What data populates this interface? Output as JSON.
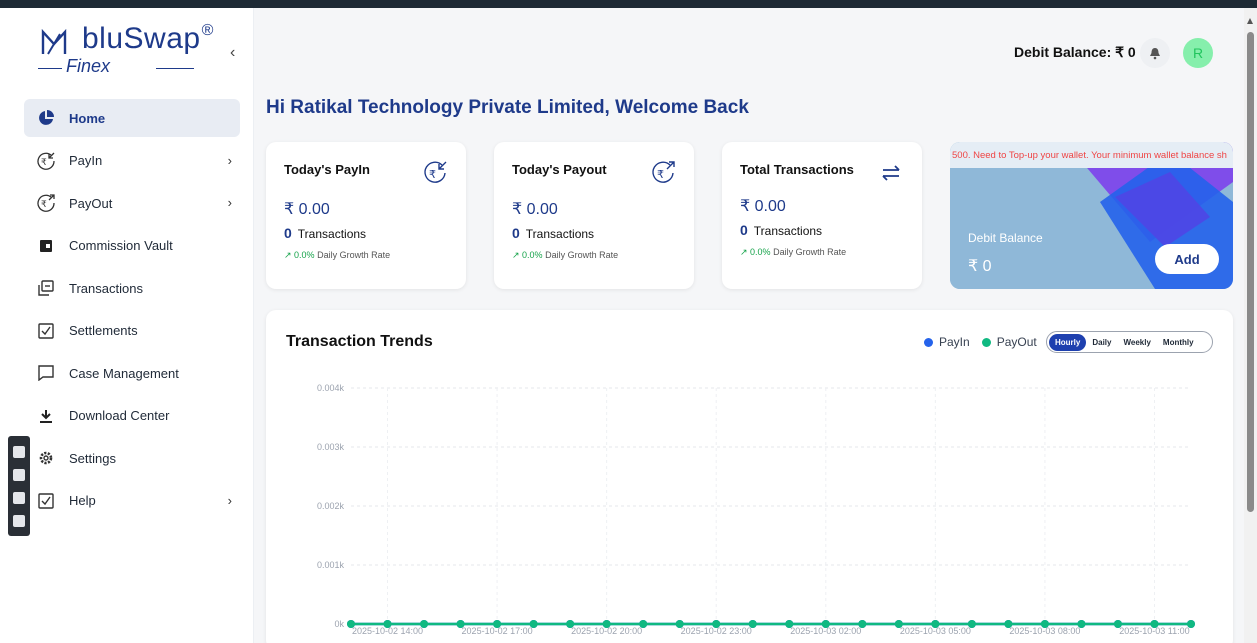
{
  "brand": {
    "name": "bluSwap",
    "registered": "®",
    "sub": "Finex"
  },
  "sidebar": {
    "items": [
      {
        "label": "Home",
        "icon": "pie-chart-icon",
        "active": true,
        "has_children": false
      },
      {
        "label": "PayIn",
        "icon": "rupee-in-icon",
        "active": false,
        "has_children": true
      },
      {
        "label": "PayOut",
        "icon": "rupee-out-icon",
        "active": false,
        "has_children": true
      },
      {
        "label": "Commission Vault",
        "icon": "wallet-icon",
        "active": false,
        "has_children": false
      },
      {
        "label": "Transactions",
        "icon": "transactions-icon",
        "active": false,
        "has_children": false
      },
      {
        "label": "Settlements",
        "icon": "checkbox-icon",
        "active": false,
        "has_children": false
      },
      {
        "label": "Case Management",
        "icon": "message-icon",
        "active": false,
        "has_children": false
      },
      {
        "label": "Download Center",
        "icon": "download-icon",
        "active": false,
        "has_children": false
      },
      {
        "label": "Settings",
        "icon": "gear-icon",
        "active": false,
        "has_children": false
      },
      {
        "label": "Help",
        "icon": "help-check-icon",
        "active": false,
        "has_children": true
      }
    ]
  },
  "header": {
    "debit_balance": "Debit Balance: ₹ 0",
    "avatar_initial": "R"
  },
  "welcome": "Hi Ratikal Technology Private Limited, Welcome Back",
  "cards": [
    {
      "title": "Today's PayIn",
      "amount": "₹ 0.00",
      "count": "0",
      "count_label": "Transactions",
      "growth": "0.0%",
      "growth_label": "Daily Growth Rate",
      "icon": "rupee-in-icon"
    },
    {
      "title": "Today's Payout",
      "amount": "₹ 0.00",
      "count": "0",
      "count_label": "Transactions",
      "growth": "0.0%",
      "growth_label": "Daily Growth Rate",
      "icon": "rupee-out-icon"
    },
    {
      "title": "Total Transactions",
      "amount": "₹ 0.00",
      "count": "0",
      "count_label": "Transactions",
      "growth": "0.0%",
      "growth_label": "Daily Growth Rate",
      "icon": "swap-arrows-icon"
    }
  ],
  "debit_card": {
    "marquee": "500. Need to Top-up your wallet. Your minimum wallet balance sh",
    "label": "Debit Balance",
    "amount": "₹ 0",
    "add_label": "Add"
  },
  "colors": {
    "brand": "#1e3a8a",
    "payin": "#2563eb",
    "payout": "#10b981",
    "growth": "#16a34a",
    "alert": "#ef4444"
  },
  "chart_data": {
    "type": "line",
    "title": "Transaction Trends",
    "legend": [
      "PayIn",
      "PayOut"
    ],
    "legend_placement": "top-right",
    "ranges": [
      "Hourly",
      "Daily",
      "Weekly",
      "Monthly"
    ],
    "selected_range": "Hourly",
    "y_ticks": [
      "0k",
      "0.001k",
      "0.002k",
      "0.003k",
      "0.004k"
    ],
    "ylim": [
      0,
      0.004
    ],
    "x_tick_labels": [
      "2025-10-02 14:00",
      "2025-10-02 17:00",
      "2025-10-02 20:00",
      "2025-10-02 23:00",
      "2025-10-03 02:00",
      "2025-10-03 05:00",
      "2025-10-03 08:00",
      "2025-10-03 11:00"
    ],
    "x_points": 24,
    "series": [
      {
        "name": "PayIn",
        "values": [
          0,
          0,
          0,
          0,
          0,
          0,
          0,
          0,
          0,
          0,
          0,
          0,
          0,
          0,
          0,
          0,
          0,
          0,
          0,
          0,
          0,
          0,
          0,
          0
        ]
      },
      {
        "name": "PayOut",
        "values": [
          0,
          0,
          0,
          0,
          0,
          0,
          0,
          0,
          0,
          0,
          0,
          0,
          0,
          0,
          0,
          0,
          0,
          0,
          0,
          0,
          0,
          0,
          0,
          0
        ]
      }
    ],
    "grid": true
  }
}
